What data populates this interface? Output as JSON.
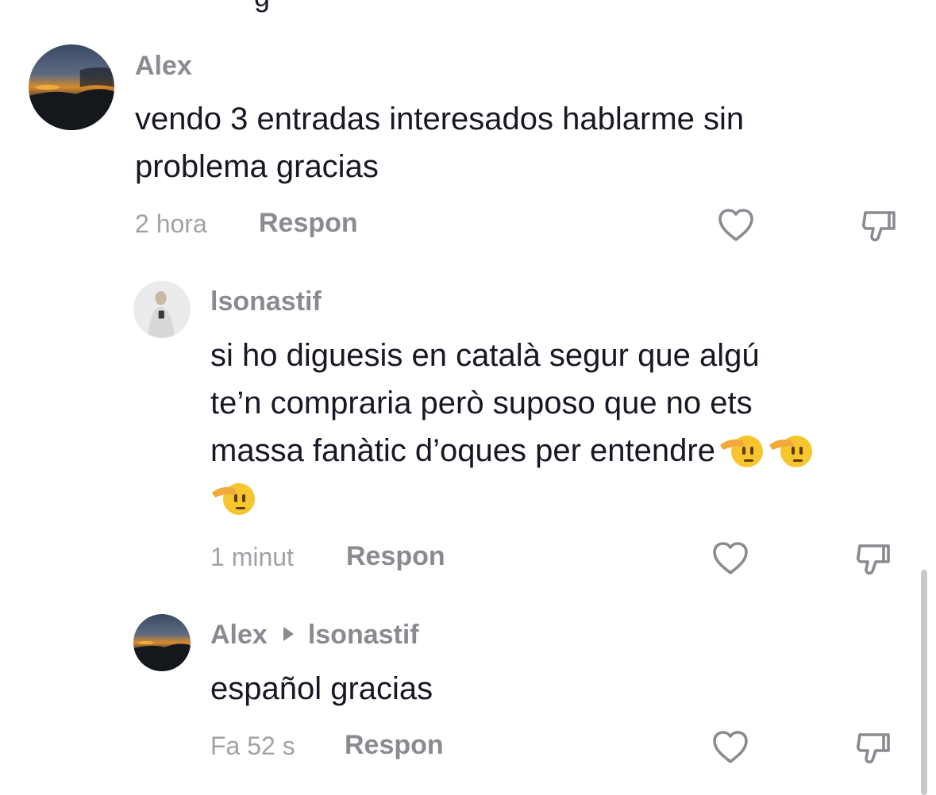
{
  "comments": [
    {
      "username": "Alex",
      "text": "vendo 3 entradas interesados hablarme sin\nproblema gracias",
      "time": "2 hora",
      "reply_label": "Respon",
      "avatar": "sunset-landscape"
    },
    {
      "username": "lsonastif",
      "text": "si ho diguesis en català segur que algú\nte’n compraria però suposo que no ets\nmassa fanàtic d’oques per entendre",
      "emoji": [
        "saluting-face",
        "saluting-face",
        "saluting-face"
      ],
      "time": "1 minut",
      "reply_label": "Respon",
      "avatar": "person-mirror-selfie"
    },
    {
      "username": "Alex",
      "reply_to": "lsonastif",
      "text": "español gracias",
      "time": "Fa 52 s",
      "reply_label": "Respon",
      "avatar": "sunset-landscape"
    }
  ],
  "icons": {
    "like": "heart-outline-icon",
    "dislike": "thumbs-down-outline-icon"
  },
  "colors": {
    "username": "#8a8b91",
    "text": "#161823",
    "meta": "#a0a1a6"
  }
}
